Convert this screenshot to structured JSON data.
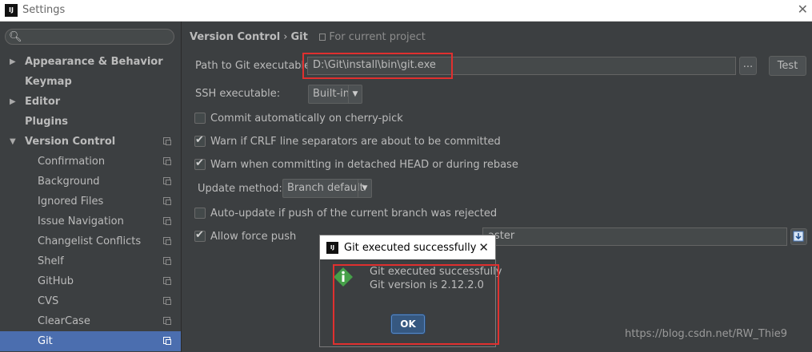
{
  "window": {
    "title": "Settings",
    "app_icon_text": "IJ"
  },
  "search": {
    "placeholder": ""
  },
  "sidebar": {
    "items": [
      {
        "label": "Appearance & Behavior",
        "arrow": "▶"
      },
      {
        "label": "Keymap"
      },
      {
        "label": "Editor",
        "arrow": "▶"
      },
      {
        "label": "Plugins"
      },
      {
        "label": "Version Control",
        "arrow": "▼"
      },
      {
        "label": "Confirmation"
      },
      {
        "label": "Background"
      },
      {
        "label": "Ignored Files"
      },
      {
        "label": "Issue Navigation"
      },
      {
        "label": "Changelist Conflicts"
      },
      {
        "label": "Shelf"
      },
      {
        "label": "GitHub"
      },
      {
        "label": "CVS"
      },
      {
        "label": "ClearCase"
      },
      {
        "label": "Git"
      }
    ],
    "selected": "Git"
  },
  "breadcrumb": {
    "parent": "Version Control",
    "separator": "›",
    "current": "Git",
    "scope": "For current project"
  },
  "form": {
    "path_label": "Path to Git executable:",
    "path_value": "D:\\Git\\install\\bin\\git.exe",
    "browse_label": "...",
    "test_label": "Test",
    "ssh_label": "SSH executable:",
    "ssh_value": "Built-in",
    "cherry_pick_label": "Commit automatically on cherry-pick",
    "cherry_pick_checked": false,
    "crlf_label": "Warn if CRLF line separators are about to be committed",
    "crlf_checked": true,
    "detached_label": "Warn when committing in detached HEAD or during rebase",
    "detached_checked": true,
    "update_method_label": "Update method:",
    "update_method_value": "Branch default",
    "auto_update_label": "Auto-update if push of the current branch was rejected",
    "auto_update_checked": false,
    "force_push_label": "Allow force push",
    "force_push_checked": true,
    "protected_branches_value": "aster"
  },
  "dialog": {
    "title": "Git executed successfully",
    "close_glyph": "✕",
    "line1": "Git executed successfully",
    "line2": "Git version is 2.12.2.0",
    "ok_label": "OK"
  },
  "watermark": "https://blog.csdn.net/RW_Thie9",
  "colors": {
    "highlight_box": "#e0302f",
    "selected_row": "#4b6eaf",
    "panel": "#3c3f41"
  }
}
